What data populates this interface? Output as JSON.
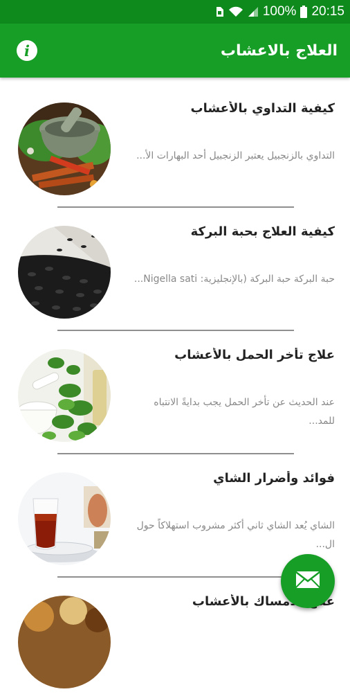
{
  "status_bar": {
    "battery": "100%",
    "time": "20:15"
  },
  "app_bar": {
    "title": "العلاج بالاعشاب",
    "info_icon": "info-icon",
    "info_glyph": "i"
  },
  "items": [
    {
      "title": "كيفية التداوي بالأعشاب",
      "description": "التداوي بالزنجبيل يعتبر الزنجبيل أحد البهارات الأ...",
      "image": "herbs-mortar-image"
    },
    {
      "title": "كيفية العلاج بحبة البركة",
      "description": "حبة البركة حبة البركة (بالإنجليزية: Nigella sati...",
      "image": "black-seeds-image"
    },
    {
      "title": "علاج تأخر الحمل بالأعشاب",
      "description": "عند الحديث عن تأخر الحمل يجب بدايةً الانتباه للمد...",
      "image": "mint-mortar-image"
    },
    {
      "title": "فوائد وأضرار الشاي",
      "description": "الشاي يُعد الشاي ثاني أكثر مشروب استهلاكاً حول ال...",
      "image": "tea-glass-image"
    },
    {
      "title": "علاج الامساك بالأعشاب",
      "description": "",
      "image": "spices-image"
    }
  ],
  "fab": {
    "icon": "envelope-icon"
  }
}
